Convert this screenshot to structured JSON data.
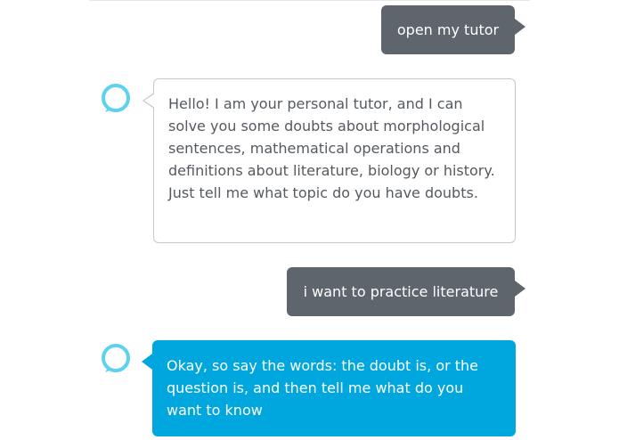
{
  "conversation": {
    "messages": [
      {
        "speaker": "user",
        "text": "open my tutor"
      },
      {
        "speaker": "alexa",
        "text": "Hello! I am your personal tutor, and I can solve you some doubts about morphological sentences, mathematical operations and definitions about literature, biology or history. Just tell me what topic do you have doubts."
      },
      {
        "speaker": "user",
        "text": "i want to practice literature"
      },
      {
        "speaker": "alexa",
        "text": "Okay, so say the words: the doubt is, or the question is, and then tell me what do you want to know"
      }
    ]
  },
  "colors": {
    "user_bubble": "#5f656d",
    "alexa_bubble_border": "#c6c9cc",
    "alexa_bubble_active": "#00a7de",
    "alexa_icon": "#5ed0f0"
  },
  "icons": {
    "alexa": "alexa-ring-icon"
  }
}
